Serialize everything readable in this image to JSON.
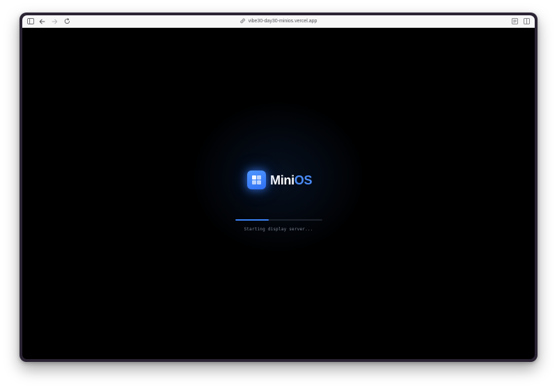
{
  "browser": {
    "url": "vibe30-day30-minios.vercel.app",
    "icons": {
      "sidebar": "sidebar-icon",
      "back": "back-arrow-icon",
      "forward": "forward-arrow-icon",
      "reload": "reload-icon",
      "link": "link-icon",
      "reader": "reader-icon",
      "split": "split-view-icon"
    }
  },
  "app": {
    "name_part1": "Mini",
    "name_part2": "OS",
    "logo_icon": "grid-icon",
    "colors": {
      "accent": "#3b82f6",
      "name_accent": "#4a8cf7",
      "background": "#000000"
    }
  },
  "boot": {
    "progress": 0.38,
    "status_text": "Starting display server..."
  }
}
